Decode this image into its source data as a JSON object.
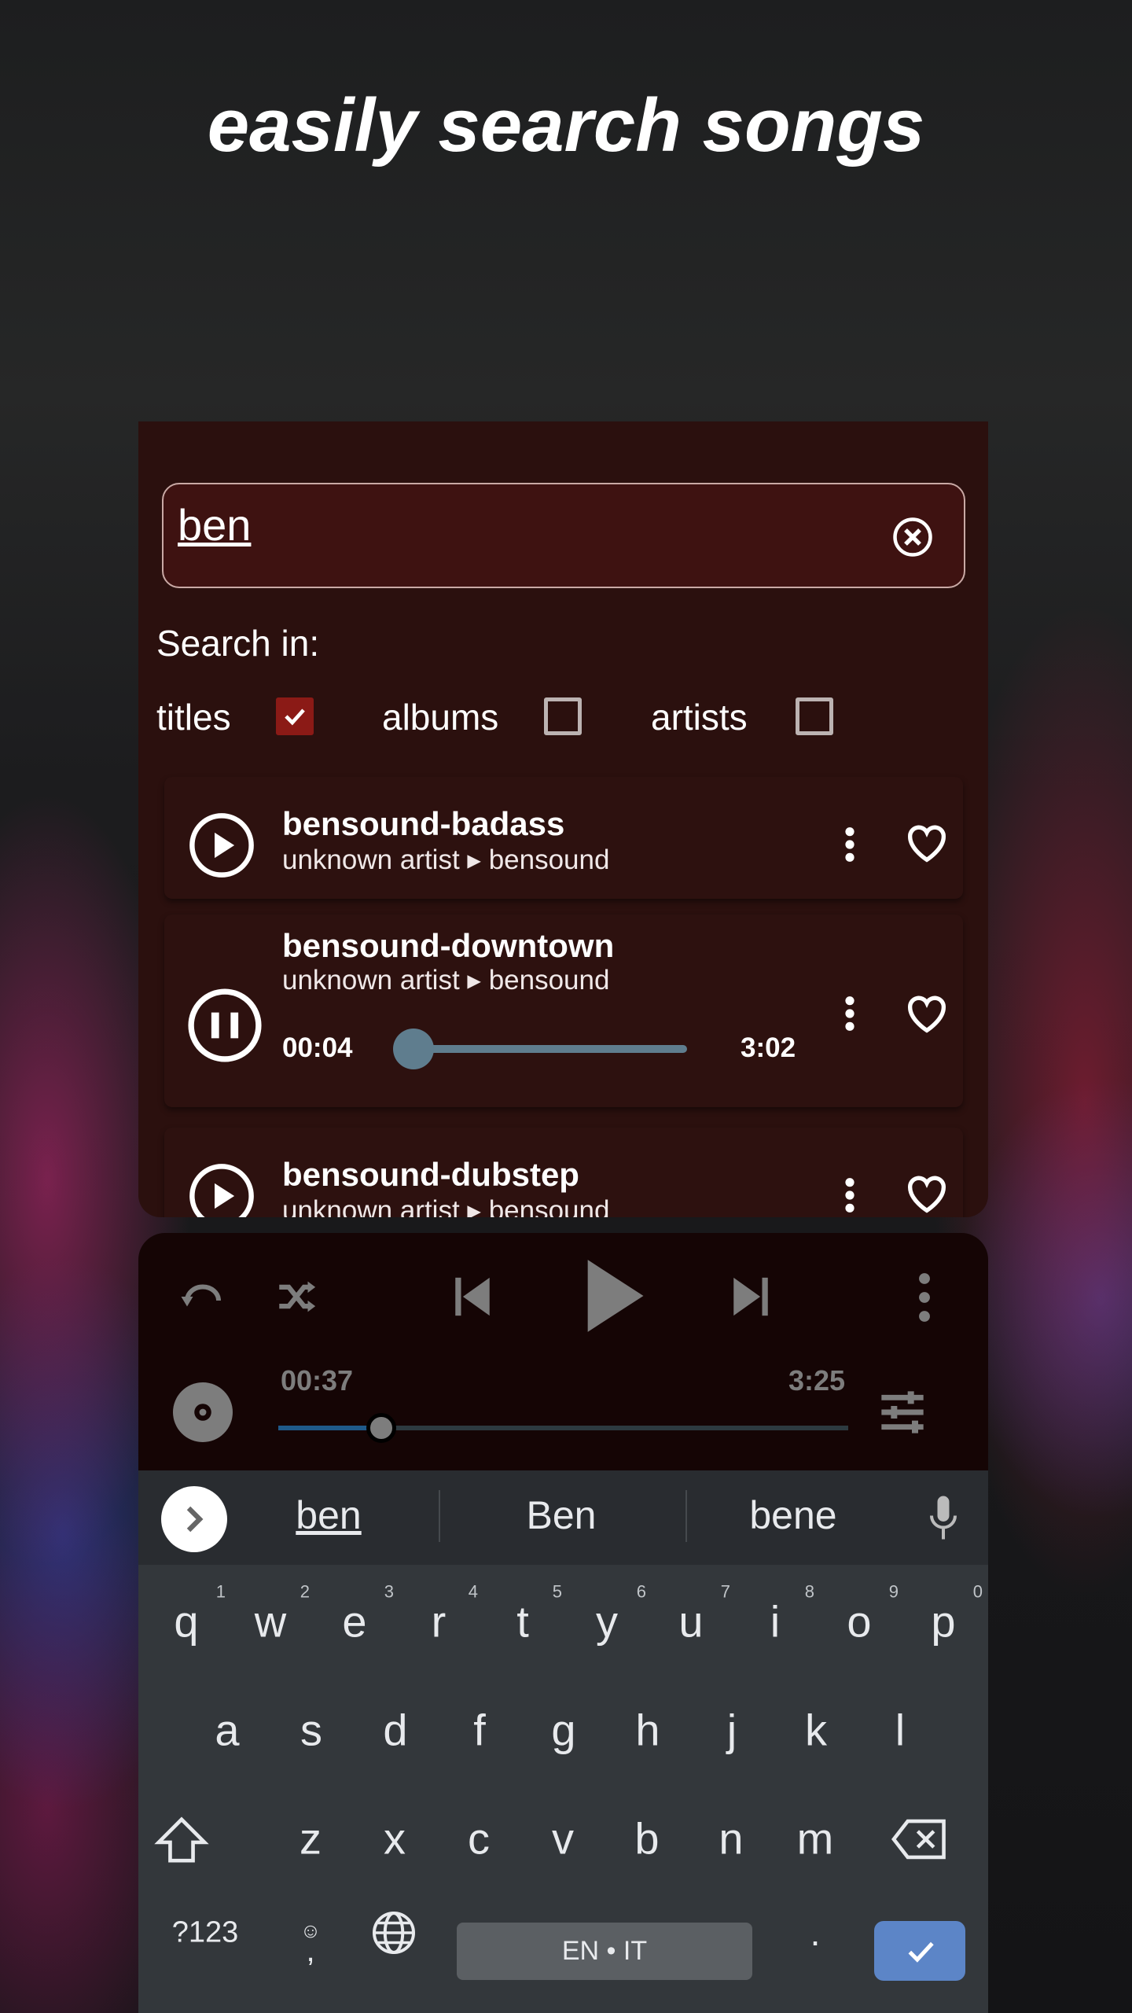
{
  "hero_title": "easily search songs",
  "search": {
    "value": "ben",
    "label": "Search in:",
    "filters": [
      {
        "label": "titles",
        "checked": true
      },
      {
        "label": "albums",
        "checked": false
      },
      {
        "label": "artists",
        "checked": false
      }
    ]
  },
  "songs": [
    {
      "title": "bensound-badass",
      "subtitle": "unknown artist ▸ bensound",
      "state": "paused"
    },
    {
      "title": "bensound-downtown",
      "subtitle": "unknown artist ▸ bensound",
      "state": "playing",
      "elapsed": "00:04",
      "duration": "3:02",
      "progress": 0.0
    },
    {
      "title": "bensound-dubstep",
      "subtitle": "unknown artist ▸ bensound",
      "state": "paused"
    }
  ],
  "player": {
    "elapsed": "00:37",
    "duration": "3:25",
    "progress": 0.18
  },
  "keyboard": {
    "suggestions": [
      "ben",
      "Ben",
      "bene"
    ],
    "row1": [
      "q",
      "w",
      "e",
      "r",
      "t",
      "y",
      "u",
      "i",
      "o",
      "p"
    ],
    "row1_hints": [
      "1",
      "2",
      "3",
      "4",
      "5",
      "6",
      "7",
      "8",
      "9",
      "0"
    ],
    "row2": [
      "a",
      "s",
      "d",
      "f",
      "g",
      "h",
      "j",
      "k",
      "l"
    ],
    "row3": [
      "z",
      "x",
      "c",
      "v",
      "b",
      "n",
      "m"
    ],
    "symbols": "?123",
    "comma": ",",
    "period": ".",
    "space": "EN • IT"
  },
  "colors": {
    "accent": "#8b1a16",
    "enter": "#5c85c7",
    "slider": "#5f7d8e"
  }
}
